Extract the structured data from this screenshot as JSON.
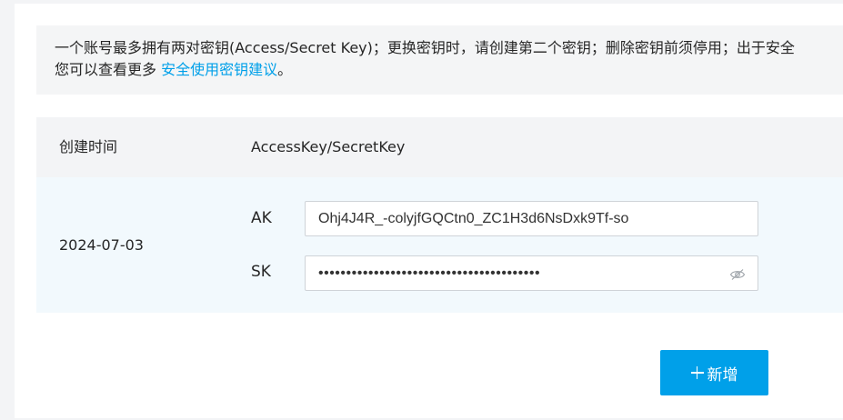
{
  "notice": {
    "line1": "一个账号最多拥有两对密钥(Access/Secret Key)；更换密钥时，请创建第二个密钥；删除密钥前须停用；出于安全",
    "line2_prefix": "您可以查看更多 ",
    "line2_link": "安全使用密钥建议",
    "line2_suffix": "。"
  },
  "table": {
    "headers": {
      "created": "创建时间",
      "keys": "AccessKey/SecretKey"
    },
    "rows": [
      {
        "created": "2024-07-03",
        "ak_label": "AK",
        "ak_value": "Ohj4J4R_-colyjfGQCtn0_ZC1H3d6NsDxk9Tf-so",
        "sk_label": "SK",
        "sk_value": "••••••••••••••••••••••••••••••••••••••••",
        "sk_toggle_icon": "eye-off-icon"
      }
    ]
  },
  "actions": {
    "add_label": "新增",
    "add_icon": "plus-icon"
  },
  "colors": {
    "accent": "#00a0e9",
    "row_highlight": "#f2f9fd",
    "header_bg": "#f3f4f6"
  }
}
